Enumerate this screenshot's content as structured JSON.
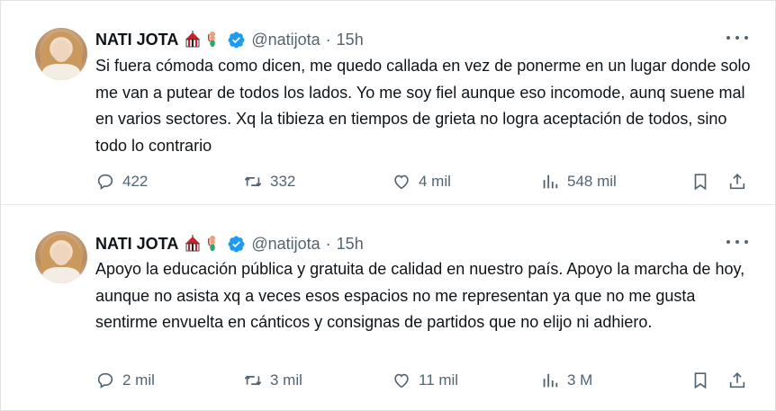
{
  "tweets": [
    {
      "name": "NATI JOTA",
      "handle": "@natijota",
      "separator": "·",
      "time": "15h",
      "text": "Si fuera cómoda como dicen, me quedo callada en vez de ponerme en un lugar donde solo me van a putear de todos los lados. Yo me soy fiel aunque eso incomode, aunq suene mal en varios sectores. Xq la tibieza en tiempos de grieta no logra aceptación de todos, sino todo lo contrario",
      "replies": "422",
      "retweets": "332",
      "likes": "4 mil",
      "views": "548 mil"
    },
    {
      "name": "NATI JOTA",
      "handle": "@natijota",
      "separator": "·",
      "time": "15h",
      "text": "Apoyo la educación pública y gratuita de calidad en nuestro país. Apoyo la marcha de hoy, aunque no asista xq a veces esos espacios no me representan ya que no me gusta sentirme envuelta en cánticos y consignas de partidos que no elijo ni adhiero.",
      "replies": "2 mil",
      "retweets": "3 mil",
      "likes": "11 mil",
      "views": "3 M"
    }
  ],
  "icons": {
    "reply": "reply-icon",
    "retweet": "retweet-icon",
    "like": "heart-icon",
    "views": "views-icon",
    "bookmark": "bookmark-icon",
    "share": "share-icon",
    "more": "more-icon",
    "verified": "verified-badge-icon",
    "emoji_1": "circus-tent-emoji",
    "emoji_2": "mermaid-emoji"
  },
  "colors": {
    "text": "#0f1419",
    "secondary": "#536471",
    "verified": "#1d9bf0",
    "divider": "#e6e9eb"
  }
}
